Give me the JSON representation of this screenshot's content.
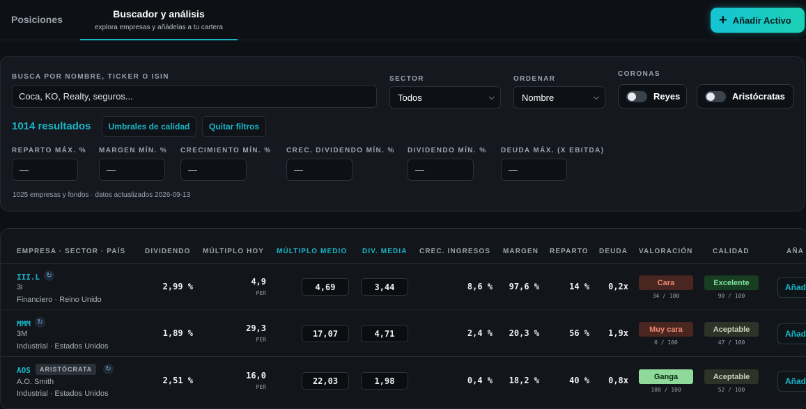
{
  "nav": {
    "tab_positions": "Posiciones",
    "tab_search_title": "Buscador y análisis",
    "tab_search_subtitle": "explora empresas y añádelas a tu cartera",
    "add_asset_label": "Añadir Activo",
    "add_asset_icon": "plus-icon"
  },
  "filters": {
    "search_label": "BUSCA POR NOMBRE, TICKER O ISIN",
    "search_placeholder": "Coca, KO, Realty, seguros...",
    "sector_label": "SECTOR",
    "sector_value": "Todos",
    "order_label": "ORDENAR",
    "order_value": "Nombre",
    "crowns_label": "CORONAS",
    "kings_label": "Reyes",
    "kings_on": false,
    "aristocrats_label": "Aristócratas",
    "aristocrats_on": false,
    "results_count": "1014 resultados",
    "quality_button": "Umbrales de calidad",
    "clear_button": "Quitar filtros",
    "thresholds": [
      {
        "label": "REPARTO MÁX. %",
        "value": "—"
      },
      {
        "label": "MARGEN MÍN. %",
        "value": "—"
      },
      {
        "label": "CRECIMIENTO MÍN. %",
        "value": "—"
      },
      {
        "label": "CREC. DIVIDENDO MÍN. %",
        "value": "—"
      },
      {
        "label": "DIVIDENDO MÍN. %",
        "value": "—"
      },
      {
        "label": "DEUDA MÁX. (X EBITDA)",
        "value": "—"
      }
    ],
    "footnote": "1025 empresas y fondos · datos actualizados 2026-09-13"
  },
  "table": {
    "headers": {
      "company": "EMPRESA · SECTOR · PAÍS",
      "dividend": "DIVIDENDO",
      "multiple_today": "MÚLTIPLO HOY",
      "multiple_avg": "MÚLTIPLO MEDIO",
      "div_avg": "DIV. MEDIA",
      "revenue_growth": "CREC. INGRESOS",
      "margin": "MARGEN",
      "payout": "REPARTO",
      "debt": "DEUDA",
      "valuation": "VALORACIÓN",
      "quality": "CALIDAD",
      "add": "AÑA"
    },
    "rows": [
      {
        "ticker": "III.L",
        "badge": "",
        "name": "3i",
        "sector_country": "Financiero · Reino Unido",
        "dividend": "2,99 %",
        "multiple_today": "4,9",
        "multiple_unit": "PER",
        "multiple_avg": "4,69",
        "div_avg": "3,44",
        "revenue_growth": "8,6 %",
        "margin": "97,6 %",
        "payout": "14 %",
        "debt": "0,2x",
        "valuation": "Cara",
        "valuation_score": "34 / 100",
        "valuation_bg": "#4a2620",
        "valuation_fg": "#f08a72",
        "quality": "Excelente",
        "quality_score": "90 / 100",
        "quality_bg": "#173d22",
        "quality_fg": "#7ee39a",
        "add_label": "Añad"
      },
      {
        "ticker": "MMM",
        "badge": "",
        "name": "3M",
        "sector_country": "Industrial · Estados Unidos",
        "dividend": "1,89 %",
        "multiple_today": "29,3",
        "multiple_unit": "PER",
        "multiple_avg": "17,07",
        "div_avg": "4,71",
        "revenue_growth": "2,4 %",
        "margin": "20,3 %",
        "payout": "56 %",
        "debt": "1,9x",
        "valuation": "Muy cara",
        "valuation_score": "0 / 100",
        "valuation_bg": "#4a2620",
        "valuation_fg": "#f08a72",
        "quality": "Aceptable",
        "quality_score": "47 / 100",
        "quality_bg": "#2e3228",
        "quality_fg": "#c9d0b8",
        "add_label": "Añad"
      },
      {
        "ticker": "AOS",
        "badge": "ARISTÓCRATA",
        "name": "A.O. Smith",
        "sector_country": "Industrial · Estados Unidos",
        "dividend": "2,51 %",
        "multiple_today": "16,0",
        "multiple_unit": "PER",
        "multiple_avg": "22,03",
        "div_avg": "1,98",
        "revenue_growth": "0,4 %",
        "margin": "18,2 %",
        "payout": "40 %",
        "debt": "0,8x",
        "valuation": "Ganga",
        "valuation_score": "100 / 100",
        "valuation_bg": "#8fd99a",
        "valuation_fg": "#0d2a12",
        "quality": "Aceptable",
        "quality_score": "52 / 100",
        "quality_bg": "#2e3228",
        "quality_fg": "#c9d0b8",
        "add_label": "Añad"
      }
    ]
  },
  "colors": {
    "accent": "#19b6c8",
    "background": "#0d1014",
    "panel": "#15191f"
  }
}
